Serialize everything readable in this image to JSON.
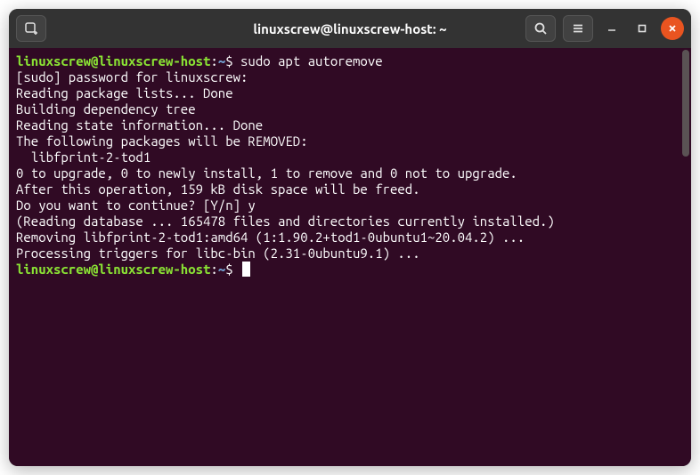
{
  "window": {
    "title": "linuxscrew@linuxscrew-host: ~"
  },
  "prompt": {
    "user_host": "linuxscrew@linuxscrew-host",
    "sep": ":",
    "cwd": "~",
    "symbol": "$"
  },
  "session": {
    "command1": "sudo apt autoremove",
    "lines": [
      "[sudo] password for linuxscrew:",
      "Reading package lists... Done",
      "Building dependency tree",
      "Reading state information... Done",
      "The following packages will be REMOVED:",
      "  libfprint-2-tod1",
      "0 to upgrade, 0 to newly install, 1 to remove and 0 not to upgrade.",
      "After this operation, 159 kB disk space will be freed.",
      "Do you want to continue? [Y/n] y",
      "(Reading database ... 165478 files and directories currently installed.)",
      "Removing libfprint-2-tod1:amd64 (1:1.90.2+tod1-0ubuntu1~20.04.2) ...",
      "Processing triggers for libc-bin (2.31-0ubuntu9.1) ..."
    ]
  },
  "icons": {
    "new_tab": "new-tab",
    "search": "search",
    "menu": "menu",
    "minimize": "minimize",
    "maximize": "maximize",
    "close": "close"
  }
}
